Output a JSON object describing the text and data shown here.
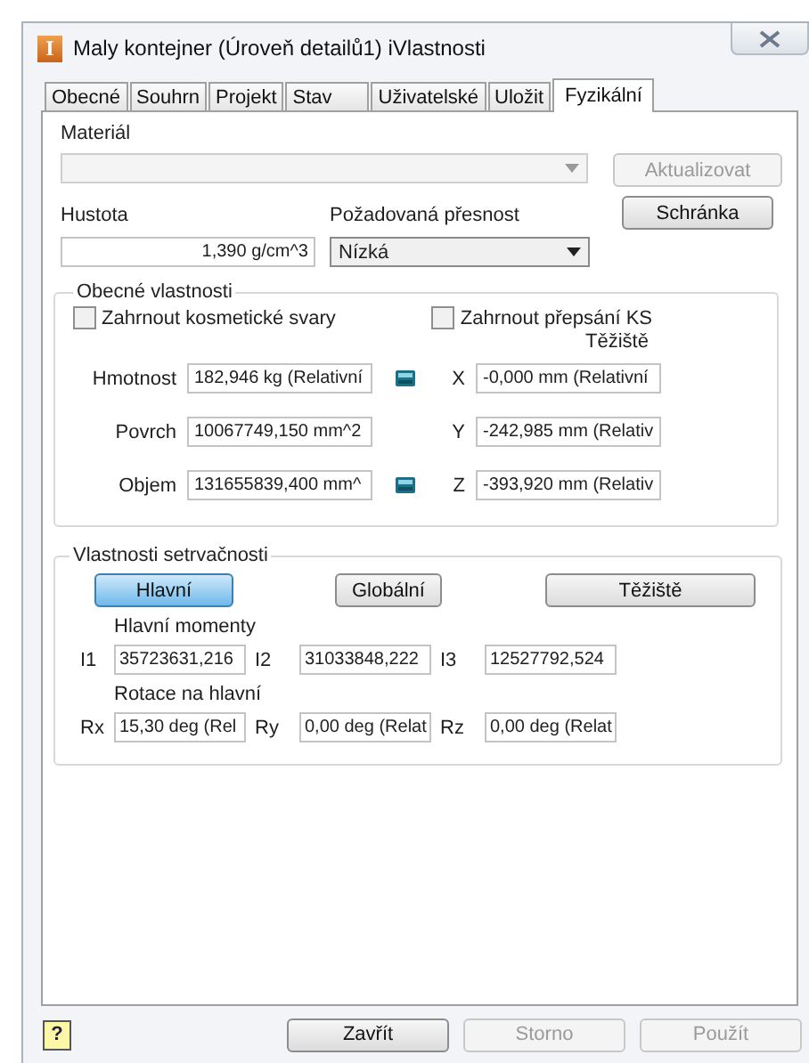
{
  "window": {
    "icon_glyph": "I",
    "title": "Maly kontejner (Úroveň detailů1) iVlastnosti"
  },
  "tabs": [
    {
      "label": "Obecné",
      "selected": false
    },
    {
      "label": "Souhrn",
      "selected": false
    },
    {
      "label": "Projekt",
      "selected": false
    },
    {
      "label": "Stav",
      "selected": false
    },
    {
      "label": "Uživatelské",
      "selected": false
    },
    {
      "label": "Uložit",
      "selected": false
    },
    {
      "label": "Fyzikální",
      "selected": true
    }
  ],
  "material": {
    "label": "Materiál",
    "disabled": true
  },
  "update_button": {
    "label": "Aktualizovat",
    "disabled": true
  },
  "density": {
    "label": "Hustota",
    "value": "1,390 g/cm^3"
  },
  "accuracy": {
    "label": "Požadovaná přesnost",
    "value": "Nízká"
  },
  "clipboard_button": {
    "label": "Schránka"
  },
  "general": {
    "title": "Obecné vlastnosti",
    "checkboxes": [
      {
        "label": "Zahrnout kosmetické svary",
        "checked": false
      },
      {
        "label": "Zahrnout přepsání KS",
        "checked": false
      }
    ],
    "center_label": "Těžiště",
    "rows": [
      {
        "label": "Hmotnost",
        "value": "182,946 kg (Relativní",
        "calculator": true,
        "axis": "X",
        "axis_value": "-0,000 mm (Relativní"
      },
      {
        "label": "Povrch",
        "value": "10067749,150 mm^2",
        "calculator": false,
        "axis": "Y",
        "axis_value": "-242,985 mm (Relativ"
      },
      {
        "label": "Objem",
        "value": "131655839,400 mm^",
        "calculator": true,
        "axis": "Z",
        "axis_value": "-393,920 mm (Relativ"
      }
    ]
  },
  "inertia": {
    "title": "Vlastnosti setrvačnosti",
    "modes": [
      {
        "label": "Hlavní",
        "selected": true
      },
      {
        "label": "Globální",
        "selected": false
      },
      {
        "label": "Těžiště",
        "selected": false
      }
    ],
    "moments_label": "Hlavní momenty",
    "moments": [
      {
        "label": "I1",
        "value": "35723631,216"
      },
      {
        "label": "I2",
        "value": "31033848,222"
      },
      {
        "label": "I3",
        "value": "12527792,524"
      }
    ],
    "rotation_label": "Rotace na hlavní",
    "rotations": [
      {
        "label": "Rx",
        "value": "15,30 deg (Rel"
      },
      {
        "label": "Ry",
        "value": "0,00 deg (Relat"
      },
      {
        "label": "Rz",
        "value": "0,00 deg (Relat"
      }
    ]
  },
  "footer": {
    "help": "?",
    "buttons": [
      {
        "label": "Zavřít",
        "disabled": false
      },
      {
        "label": "Storno",
        "disabled": true
      },
      {
        "label": "Použít",
        "disabled": true
      }
    ]
  }
}
